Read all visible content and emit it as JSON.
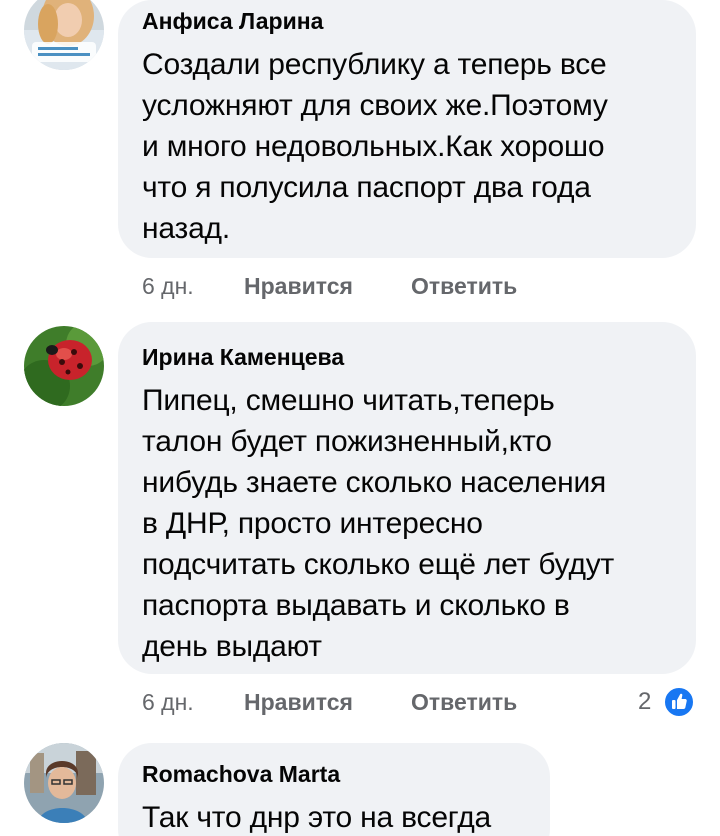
{
  "comments": [
    {
      "author": "Анфиса Ларина",
      "lines": [
        "Создали республику а теперь все",
        "усложняют для своих же.Поэтому",
        "и много недовольных.Как хорошо",
        "что я полусила паспорт два года",
        "назад."
      ],
      "time": "6 дн.",
      "like_label": "Нравится",
      "reply_label": "Ответить"
    },
    {
      "author": "Ирина Каменцева",
      "lines": [
        "Пипец, смешно читать,теперь",
        "талон будет пожизненный,кто",
        "нибудь знаете сколько населения",
        "в ДНР, просто интересно",
        "подсчитать сколько ещё лет будут",
        "паспорта выдавать и сколько в",
        "день выдают"
      ],
      "time": "6 дн.",
      "like_label": "Нравится",
      "reply_label": "Ответить",
      "reaction_count": "2"
    },
    {
      "author": "Romachova Marta",
      "lines": [
        "Так что днр это на всегда"
      ]
    }
  ],
  "colors": {
    "bubble": "#f0f2f5",
    "secondary_text": "#65676b",
    "like_blue": "#1877f2"
  },
  "icons": {
    "avatar_1": "woman-portrait-avatar",
    "avatar_2": "ladybug-avatar",
    "avatar_3": "woman-outdoor-avatar",
    "reaction": "thumbs-up-icon"
  }
}
